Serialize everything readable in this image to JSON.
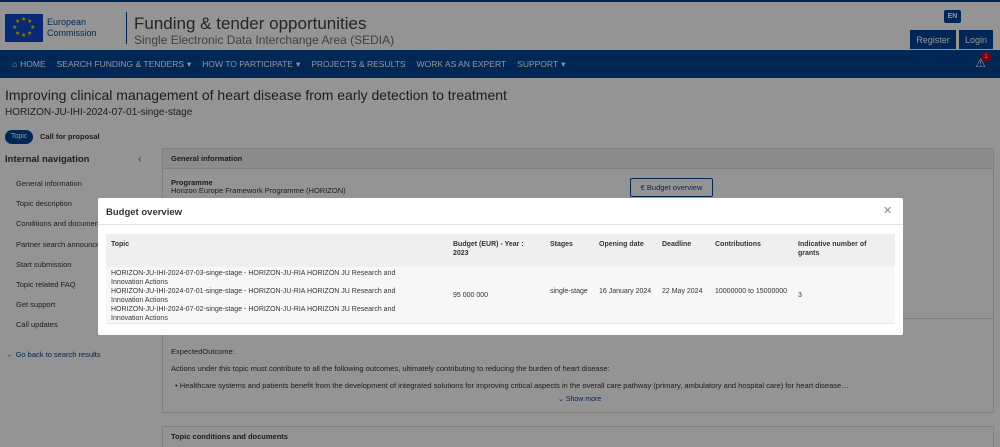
{
  "header": {
    "logo_line1": "European",
    "logo_line2": "Commission",
    "site_title": "Funding & tender opportunities",
    "site_subtitle": "Single Electronic Data Interchange Area (SEDIA)",
    "language": "EN",
    "register_label": "Register",
    "login_label": "Login"
  },
  "nav": {
    "home": "HOME",
    "search": "SEARCH FUNDING & TENDERS",
    "participate": "HOW TO PARTICIPATE",
    "projects": "PROJECTS & RESULTS",
    "expert": "WORK AS AN EXPERT",
    "support": "SUPPORT",
    "alert_count": "1"
  },
  "page": {
    "title": "Improving clinical management of heart disease from early detection to treatment",
    "identifier": "HORIZON-JU-IHI-2024-07-01-singe-stage",
    "pill_topic": "Topic",
    "pill_call": "Call for proposal"
  },
  "sidebar": {
    "heading": "Internal navigation",
    "items": [
      "General information",
      "Topic description",
      "Conditions and documents",
      "Partner search announcements",
      "Start submission",
      "Topic related FAQ",
      "Get support",
      "Call updates"
    ],
    "back_link": "Go back to search results"
  },
  "general": {
    "heading": "General information",
    "programme_label": "Programme",
    "programme_value": "Horizon Europe Framework Programme (HORIZON)",
    "budget_button": "Budget overview"
  },
  "description": {
    "expected_label": "ExpectedOutcome:",
    "expected_text": "Actions under this topic must contribute to all the following outcomes, ultimately contributing to reducing the burden of heart disease:",
    "bullet": "Healthcare systems and patients benefit from the development of integrated solutions for improving critical aspects in the overall care pathway (primary, ambulatory and hospital care) for heart disease…",
    "show_more": "Show more"
  },
  "conditions": {
    "heading": "Topic conditions and documents"
  },
  "modal": {
    "title": "Budget overview",
    "columns": {
      "topic": "Topic",
      "budget": "Budget (EUR) - Year : 2023",
      "stages": "Stages",
      "opening": "Opening date",
      "deadline": "Deadline",
      "contributions": "Contributions",
      "grants": "Indicative number of grants"
    },
    "row": {
      "topic_1": "HORIZON-JU-IHI-2024-07-03-singe-stage - HORIZON-JU-RIA HORIZON JU Research and Innovation Actions",
      "topic_2": "HORIZON-JU-IHI-2024-07-01-singe-stage - HORIZON-JU-RIA HORIZON JU Research and Innovation Actions",
      "topic_3": "HORIZON-JU-IHI-2024-07-02-singe-stage - HORIZON-JU-RIA HORIZON JU Research and Innovation Actions",
      "budget": "95 000 000",
      "stages": "single-stage",
      "opening": "16 January 2024",
      "deadline": "22 May 2024",
      "contributions": "10000000 to 15000000",
      "grants": "3"
    }
  }
}
